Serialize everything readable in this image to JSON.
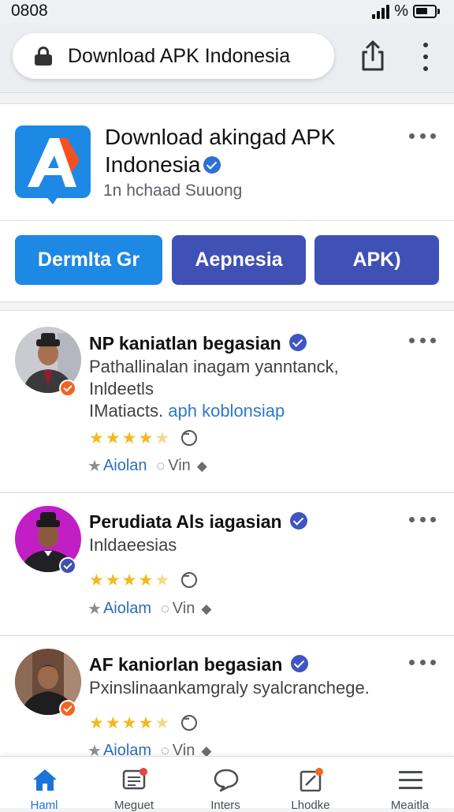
{
  "status": {
    "time": "0808",
    "battery_label": "%"
  },
  "browser": {
    "url": "Download APK Indonesia",
    "icons": [
      "lock-icon",
      "share-icon",
      "more-vert-icon"
    ]
  },
  "app": {
    "title": "Download akingad APK Indonesia",
    "subtitle": "1n hchaad Suuong",
    "buttons": [
      {
        "label": "Dermlta Gr",
        "color": "#1e88e5"
      },
      {
        "label": "Aepnesia",
        "color": "#3f51b5"
      },
      {
        "label": "APK)",
        "color": "#3f51b5"
      }
    ]
  },
  "reviews": [
    {
      "name": "NP kaniatlan begasian",
      "lines": [
        "Pathallinalan inagam yanntanck,",
        "Inldeetls"
      ],
      "link_prefix": "IMatiacts.",
      "link_text": "aph koblonsiap",
      "rating": 4.5,
      "badge_color": "#f26522",
      "actions": {
        "label": "Aiolan",
        "vin": "Vin"
      }
    },
    {
      "name": "Perudiata Als iagasian",
      "lines": [
        "Inldaeesias"
      ],
      "rating": 4,
      "badge_color": "#3f51b5",
      "actions": {
        "label": "Aiolam",
        "vin": "Vin"
      }
    },
    {
      "name": "AF kaniorlan begasian",
      "lines": [
        "Pxinslinaankamgraly syalcranchege."
      ],
      "rating": 4,
      "badge_color": "#f26522",
      "actions": {
        "label": "Aiolam",
        "vin": "Vin"
      }
    }
  ],
  "nav": [
    {
      "label": "Haml",
      "icon": "home-icon",
      "active": true
    },
    {
      "label": "Meguet",
      "icon": "message-icon"
    },
    {
      "label": "Inters",
      "icon": "chat-bubble-icon"
    },
    {
      "label": "Lhodke",
      "icon": "bookmark-icon"
    },
    {
      "label": "Meaitla",
      "icon": "menu-icon"
    }
  ],
  "colors": {
    "accent": "#1e88e5",
    "indigo": "#3f51b5",
    "star": "#f3b81c",
    "link": "#2d7ac8"
  }
}
